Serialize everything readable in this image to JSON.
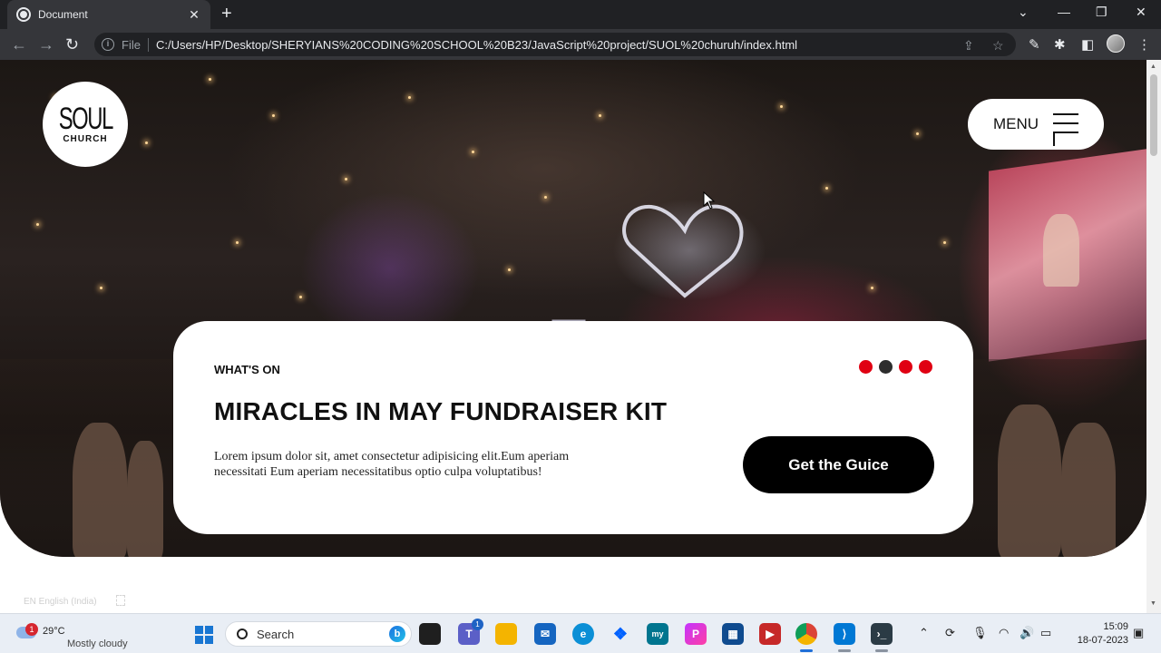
{
  "browser": {
    "tab_title": "Document",
    "tab_close": "✕",
    "new_tab": "+",
    "window_controls": {
      "collapse": "⌄",
      "minimize": "—",
      "maximize": "❐",
      "close": "✕"
    },
    "nav": {
      "back": "←",
      "forward": "→",
      "reload": "↻"
    },
    "omnibox": {
      "scheme_label": "File",
      "url": "C:/Users/HP/Desktop/SHERYIANS%20CODING%20SCHOOL%20B23/JavaScript%20project/SUOL%20churuh/index.html"
    }
  },
  "site": {
    "logo": {
      "line1": "SOUL",
      "line2": "CHURCH"
    },
    "menu_label": "MENU",
    "card": {
      "eyebrow": "WHAT'S ON",
      "heading": "MIRACLES IN MAY FUNDRAISER KIT",
      "description": "Lorem ipsum dolor sit, amet consectetur adipisicing elit.Eum aperiam necessitati Eum aperiam necessitatibus optio culpa voluptatibus!",
      "cta_label": "Get the Guice",
      "slider_total": 4,
      "slider_active_index": 1,
      "prev_arrow": "‹",
      "next_arrow": "›"
    },
    "language_indicator": "EN English (India)"
  },
  "colors": {
    "accent_red": "#e00012",
    "dark_dot": "#2d2d2d",
    "cta_bg": "#000000"
  },
  "taskbar": {
    "weather": {
      "alert_count": "1",
      "temperature": "29°C",
      "condition": "Mostly cloudy"
    },
    "search_placeholder": "Search",
    "teams_badge": "1",
    "apps": [
      "file-explorer",
      "teams",
      "folder",
      "mail",
      "edge",
      "dropbox",
      "mysql",
      "picsart",
      "store",
      "video-player",
      "chrome",
      "vscode",
      "terminal"
    ],
    "clock": {
      "time": "15:09",
      "date": "18-07-2023"
    }
  }
}
